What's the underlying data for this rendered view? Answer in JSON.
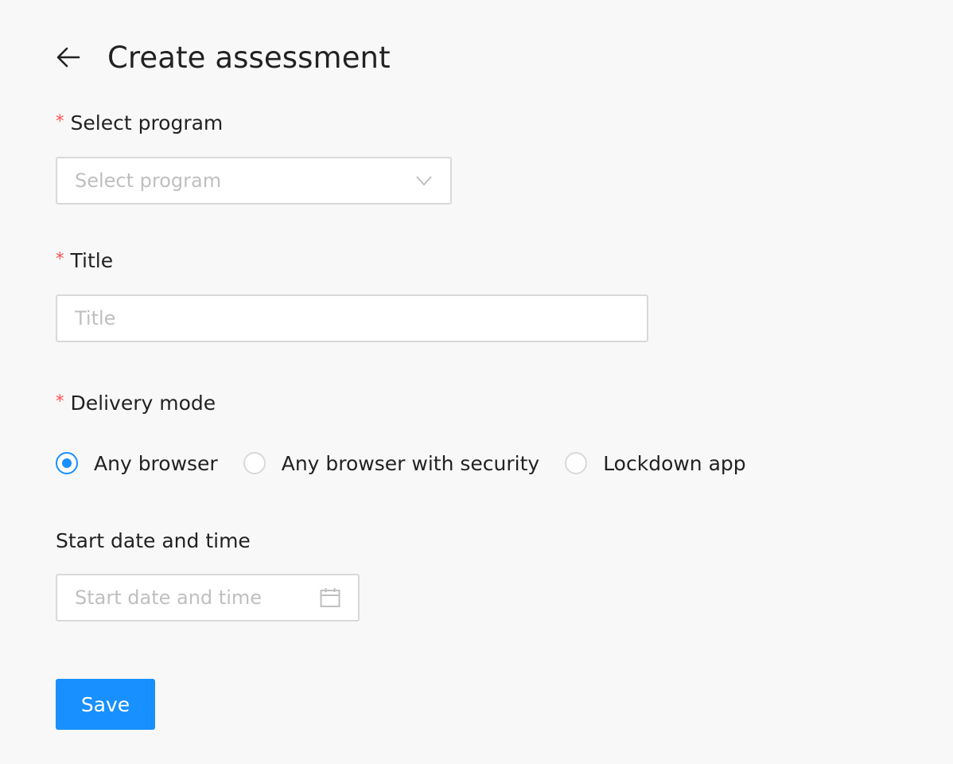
{
  "header": {
    "back_icon": "arrow-left-icon",
    "title": "Create assessment"
  },
  "program": {
    "required_mark": "*",
    "label": "Select program",
    "placeholder": "Select program",
    "icon": "chevron-down-icon"
  },
  "title_field": {
    "required_mark": "*",
    "label": "Title",
    "placeholder": "Title"
  },
  "delivery_mode": {
    "required_mark": "*",
    "label": "Delivery mode",
    "options": [
      {
        "label": "Any browser",
        "checked": true
      },
      {
        "label": "Any browser with security",
        "checked": false
      },
      {
        "label": "Lockdown app",
        "checked": false
      }
    ]
  },
  "start_date": {
    "label": "Start date and time",
    "placeholder": "Start date and time",
    "icon": "calendar-icon"
  },
  "actions": {
    "save_label": "Save"
  },
  "colors": {
    "primary": "#1890ff",
    "required": "#ff4d4f",
    "border": "#d9d9d9",
    "placeholder": "#bfbfbf",
    "background": "#f8f8f8"
  }
}
